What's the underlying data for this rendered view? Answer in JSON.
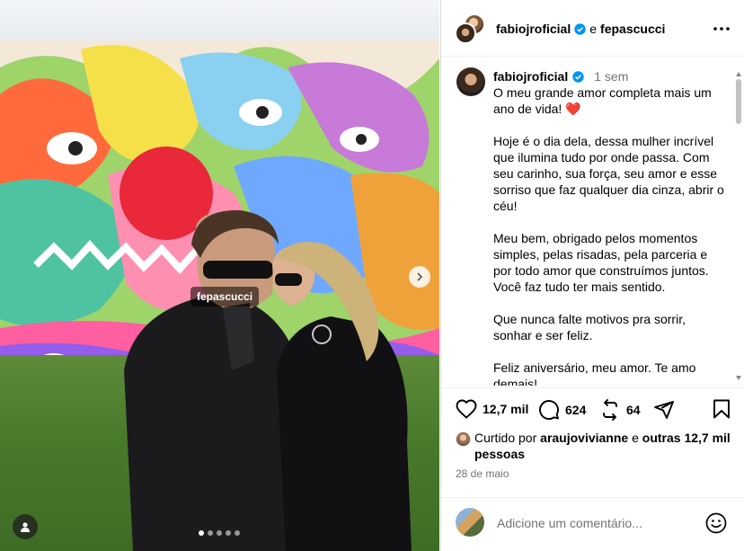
{
  "post": {
    "photo_tag": "fepascucci",
    "carousel": {
      "count": 5,
      "active": 0
    }
  },
  "header": {
    "author": "fabiojroficial",
    "conjunction": "e",
    "coauthor": "fepascucci",
    "icons": {
      "verified": "verified-badge-icon",
      "more": "more-options-icon"
    }
  },
  "caption": {
    "author": "fabiojroficial",
    "time": "1 sem",
    "paragraphs": [
      "O meu grande amor completa mais um ano de vida! ❤️",
      "Hoje é o dia dela, dessa mulher incrível que ilumina tudo por onde passa. Com seu carinho, sua força, seu amor e esse sorriso que faz qualquer dia cinza, abrir o céu!",
      "Meu bem, obrigado pelos momentos simples, pelas risadas, pela parceria e por todo amor que construímos juntos. Você faz tudo ter mais sentido.",
      "Que nunca falte motivos pra sorrir, sonhar e ser feliz.",
      "Feliz aniversário, meu amor. Te amo demais!"
    ]
  },
  "actions": {
    "likes_count": "12,7 mil",
    "comments_count": "624",
    "reposts_count": "64",
    "icons": [
      "heart-icon",
      "comment-icon",
      "repost-icon",
      "share-icon",
      "save-icon"
    ]
  },
  "likes": {
    "prefix": "Curtido por",
    "user": "araujovivianne",
    "middle": "e",
    "others": "outras 12,7 mil pessoas"
  },
  "date": "28 de maio",
  "comment": {
    "placeholder": "Adicione um comentário..."
  },
  "colors": {
    "verified": "#0095f6",
    "muted": "#737373",
    "heart": "#e0245e"
  }
}
